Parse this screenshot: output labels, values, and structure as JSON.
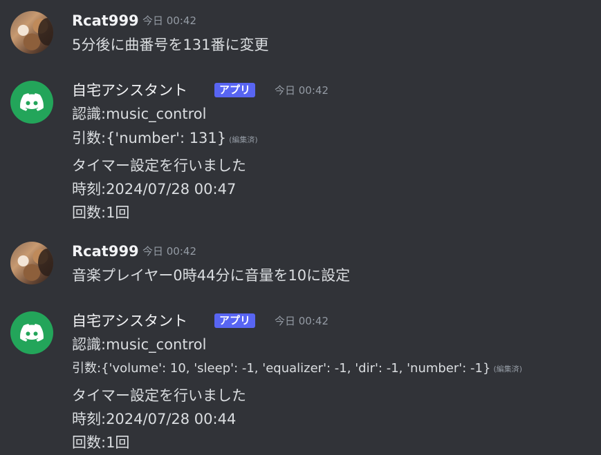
{
  "messages": [
    {
      "author": "Rcat999",
      "timestamp": "今日 00:42",
      "lines": [
        "5分後に曲番号を131番に変更"
      ]
    },
    {
      "author": "自宅アシスタント",
      "badge": "アプリ",
      "timestamp": "今日 00:42",
      "lines": [
        "認識:music_control",
        "引数:{'number': 131}",
        "タイマー設定を行いました",
        "時刻:2024/07/28 00:47",
        "回数:1回"
      ],
      "edited": "(編集済)"
    },
    {
      "author": "Rcat999",
      "timestamp": "今日 00:42",
      "lines": [
        "音楽プレイヤー0時44分に音量を10に設定"
      ]
    },
    {
      "author": "自宅アシスタント",
      "badge": "アプリ",
      "timestamp": "今日 00:42",
      "lines": [
        "認識:music_control",
        "引数:{'volume': 10, 'sleep': -1, 'equalizer': -1, 'dir': -1, 'number': -1}",
        "タイマー設定を行いました",
        "時刻:2024/07/28 00:44",
        "回数:1回"
      ],
      "edited": "(編集済)"
    }
  ],
  "icons": {
    "user_avatar": "cat-avatar-icon",
    "bot_avatar": "discord-logo-icon"
  },
  "colors": {
    "background": "#313338",
    "text": "#dbdee1",
    "username": "#f2f3f5",
    "timestamp": "#949ba4",
    "badge": "#5865f2",
    "bot_avatar": "#23a55a"
  }
}
